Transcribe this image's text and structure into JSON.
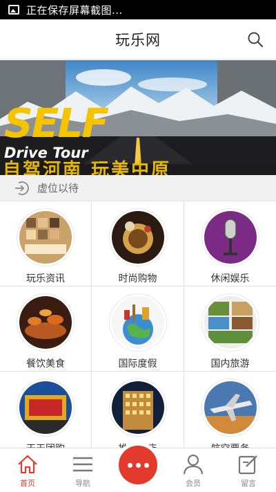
{
  "status_bar": {
    "text": "正在保存屏幕截图..."
  },
  "header": {
    "title": "玩乐网"
  },
  "banner": {
    "headline": "SELF",
    "subline": "Drive Tour",
    "caption": "自驾河南 玩美中原"
  },
  "notice": {
    "text": "虚位以待"
  },
  "grid": {
    "items": [
      {
        "label": "玩乐资讯",
        "icon": "news-icon"
      },
      {
        "label": "时尚购物",
        "icon": "shopping-icon"
      },
      {
        "label": "休闲娱乐",
        "icon": "microphone-icon"
      },
      {
        "label": "餐饮美食",
        "icon": "food-icon"
      },
      {
        "label": "国际度假",
        "icon": "globe-icon"
      },
      {
        "label": "国内旅游",
        "icon": "landscape-icon"
      },
      {
        "label": "天天团购",
        "icon": "group-buy-icon"
      },
      {
        "label": "推荐酒店",
        "icon": "hotel-icon"
      },
      {
        "label": "航空票务",
        "icon": "airplane-icon"
      }
    ]
  },
  "bottom_nav": {
    "home": "首页",
    "guide": "导航",
    "member": "会员",
    "message": "留言"
  },
  "colors": {
    "accent": "#e23b2e",
    "divider": "#e2e2e2"
  }
}
